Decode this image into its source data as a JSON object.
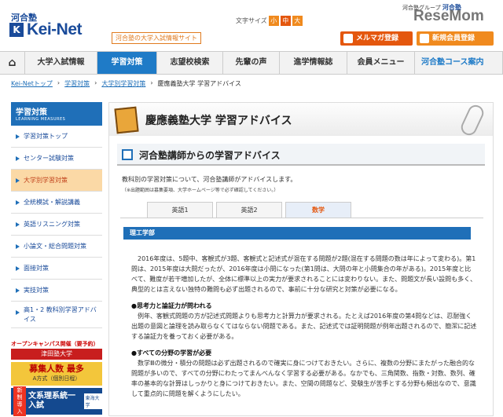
{
  "header": {
    "logo_top": "河合塾",
    "logo_mark": "K",
    "logo_text": "Kei-Net",
    "tagline": "河合塾の大学入試情報サイト",
    "font_size_label": "文字サイズ",
    "font_sizes": [
      "小",
      "中",
      "大"
    ],
    "group_label": "河合塾グループ",
    "group_name": "河合塾",
    "watermark": "ReseMom",
    "mail_button": "メルマガ登録",
    "register_button": "新規会員登録"
  },
  "nav": {
    "home_icon": "⌂",
    "items": [
      "大学入試情報",
      "学習対策",
      "志望校検索",
      "先輩の声",
      "進学情報誌",
      "会員メニュー"
    ],
    "course": "河合塾コース案内"
  },
  "breadcrumb": [
    "Kei-Netトップ",
    "学習対策",
    "大学別学習対策",
    "慶應義塾大学 学習アドバイス"
  ],
  "sidebar": {
    "title": "学習対策",
    "subtitle": "LEARNING MEASURES",
    "items": [
      "学習対策トップ",
      "センター試験対策",
      "大学別学習対策",
      "全統模試・解説講義",
      "英語リスニング対策",
      "小論文・総合問題対策",
      "面接対策",
      "実技対策",
      "高1・2 教科別学習アドバイス"
    ]
  },
  "banners": {
    "open_campus": "オープンキャンパス開催（要予約）",
    "school": "津田塾大学",
    "recruit": "募集人数 最多",
    "recruit_sub": "A方式（個別日程）",
    "new_label": "新制導入",
    "new_title": "文系理系統一入試",
    "univ": "東海大学"
  },
  "main": {
    "title": "慶應義塾大学 学習アドバイス",
    "subtitle": "河合塾講師からの学習アドバイス",
    "intro": "教科別の学習対策について、河合塾講師がアドバイスします。",
    "note": "（※出題範囲は募集要項、大学ホームページ等で必ず確認してください。）",
    "tabs": [
      "英語1",
      "英語2",
      "数学"
    ],
    "section": "理工学部",
    "para1": "2016年度は、5題中、客観式が3題、客観式と記述式が混在する問題が2題(混在する問題の数は年によって変わる)。第1問は、2015年度は大問だったが、2016年度は小問になった(第1問は、大問の年と小問集合の年がある)。2015年度と比べて、難度が若干増加したが、全体に標準以上の実力が要求されることには変わりない。また、問題文が長い設問も多く、典型的とは言えない独特の難問も必ず出題されるので、事前に十分な研究と対策が必要になる。",
    "h2": "●思考力と論証力が問われる",
    "para2": "例年、客観式問題の方が記述式問題よりも思考力と計算力が要求される。たとえば2016年度の第4問などは、忍耐強く出題の意図と論理を読み取らなくてはならない問題である。また、記述式では証明問題が例年出題されるので、簡潔に記述する論証力を養っておく必要がある。",
    "h3": "●すべての分野の学習が必要",
    "para3": "数学Ⅲの微分・積分の問題は必ず出題されるので確実に身につけておきたい。さらに、複数の分野にまたがった融合的な問題が多いので、すべての分野にわたってまんべんなく学習する必要がある。なかでも、三角関数、指数・対数、数列、確率の基本的な計算はしっかりと身につけておきたい。また、空間の問題など、受験生が苦手とする分野も頻出なので、意識して重点的に問題を解くようにしたい。"
  }
}
